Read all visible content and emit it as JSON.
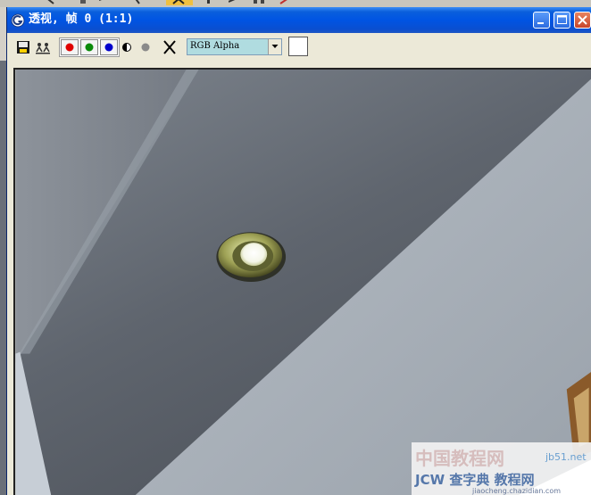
{
  "window": {
    "title": "透视, 帧 0 (1:1)",
    "controls": [
      "minimize",
      "maximize",
      "close"
    ]
  },
  "toolbar": {
    "buttons": [
      "save-icon",
      "clone-icon",
      "red-channel",
      "green-channel",
      "blue-channel",
      "monochrome",
      "alpha-channel",
      "clear-icon"
    ],
    "channel_select": {
      "value": "RGB Alpha"
    },
    "swatch_color": "#ffffff"
  },
  "colors": {
    "titlebar": "#0054e3",
    "red": "#e00000",
    "green": "#0a8a0a",
    "blue": "#0000cc"
  },
  "watermark": {
    "site": "jb51.net",
    "line1": "中国教程网",
    "line2": "JCW 查字典 教程网",
    "url": "jiaocheng.chazidian.com"
  }
}
